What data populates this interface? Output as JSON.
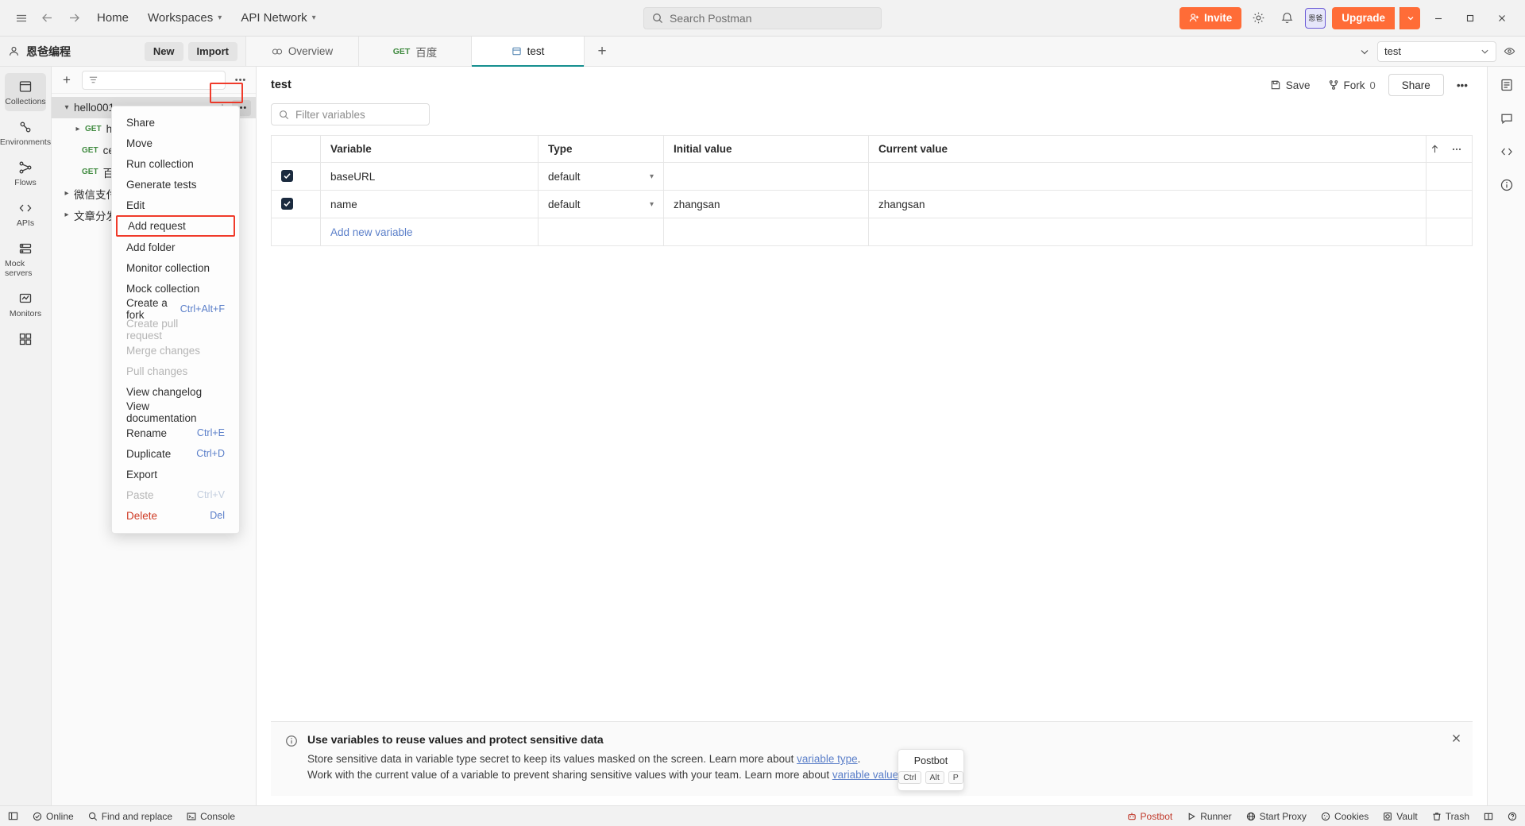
{
  "topbar": {
    "menu_icon": "hamburger-icon",
    "back_icon": "arrow-left-icon",
    "forward_icon": "arrow-right-icon",
    "home_label": "Home",
    "workspaces_label": "Workspaces",
    "api_network_label": "API Network",
    "search_placeholder": "Search Postman",
    "invite_label": "Invite",
    "upgrade_label": "Upgrade",
    "avatar_initials": "恩爸",
    "minimize_label": "—",
    "maximize_label": "□",
    "close_label": "✕"
  },
  "workspace": {
    "name": "恩爸编程",
    "new_label": "New",
    "import_label": "Import"
  },
  "tabs": [
    {
      "label": "Overview",
      "method": "",
      "active": false,
      "icon": "overview-icon"
    },
    {
      "label": "百度",
      "method": "GET",
      "active": false,
      "icon": ""
    },
    {
      "label": "test",
      "method": "",
      "active": true,
      "icon": "collection-icon"
    }
  ],
  "tabstrip": {
    "add_tab_label": "+",
    "chevron_label": "∨",
    "environment_selected": "test"
  },
  "rail": [
    {
      "label": "Collections",
      "icon": "collections-icon",
      "active": true
    },
    {
      "label": "Environments",
      "icon": "environments-icon",
      "active": false
    },
    {
      "label": "Flows",
      "icon": "flows-icon",
      "active": false
    },
    {
      "label": "APIs",
      "icon": "apis-icon",
      "active": false
    },
    {
      "label": "Mock servers",
      "icon": "mock-servers-icon",
      "active": false
    },
    {
      "label": "Monitors",
      "icon": "monitors-icon",
      "active": false
    },
    {
      "label": "",
      "icon": "more-apps-icon",
      "active": false
    }
  ],
  "sidebar": {
    "filter_placeholder": "",
    "plus_label": "+",
    "dots_label": "•••",
    "tree": [
      {
        "label": "hello001",
        "type": "collection",
        "selected": true,
        "expanded": true,
        "indent": 0,
        "method": ""
      },
      {
        "label": "he",
        "type": "request",
        "selected": false,
        "expanded": false,
        "indent": 1,
        "method": "GET"
      },
      {
        "label": "ce",
        "type": "request",
        "selected": false,
        "expanded": false,
        "indent": 2,
        "method": "GET"
      },
      {
        "label": "百..",
        "type": "request",
        "selected": false,
        "expanded": false,
        "indent": 2,
        "method": "GET"
      },
      {
        "label": "微信支付 ..",
        "type": "collection",
        "selected": false,
        "expanded": false,
        "indent": 0,
        "method": ""
      },
      {
        "label": "文章分发平..",
        "type": "collection",
        "selected": false,
        "expanded": false,
        "indent": 0,
        "method": ""
      }
    ]
  },
  "context_menu": {
    "items": [
      {
        "label": "Share",
        "shortcut": "",
        "disabled": false,
        "danger": false,
        "highlight": false
      },
      {
        "label": "Move",
        "shortcut": "",
        "disabled": false,
        "danger": false,
        "highlight": false
      },
      {
        "label": "Run collection",
        "shortcut": "",
        "disabled": false,
        "danger": false,
        "highlight": false
      },
      {
        "label": "Generate tests",
        "shortcut": "",
        "disabled": false,
        "danger": false,
        "highlight": false
      },
      {
        "label": "Edit",
        "shortcut": "",
        "disabled": false,
        "danger": false,
        "highlight": false
      },
      {
        "label": "Add request",
        "shortcut": "",
        "disabled": false,
        "danger": false,
        "highlight": true
      },
      {
        "label": "Add folder",
        "shortcut": "",
        "disabled": false,
        "danger": false,
        "highlight": false
      },
      {
        "label": "Monitor collection",
        "shortcut": "",
        "disabled": false,
        "danger": false,
        "highlight": false
      },
      {
        "label": "Mock collection",
        "shortcut": "",
        "disabled": false,
        "danger": false,
        "highlight": false
      },
      {
        "label": "Create a fork",
        "shortcut": "Ctrl+Alt+F",
        "disabled": false,
        "danger": false,
        "highlight": false
      },
      {
        "label": "Create pull request",
        "shortcut": "",
        "disabled": true,
        "danger": false,
        "highlight": false
      },
      {
        "label": "Merge changes",
        "shortcut": "",
        "disabled": true,
        "danger": false,
        "highlight": false
      },
      {
        "label": "Pull changes",
        "shortcut": "",
        "disabled": true,
        "danger": false,
        "highlight": false
      },
      {
        "label": "View changelog",
        "shortcut": "",
        "disabled": false,
        "danger": false,
        "highlight": false
      },
      {
        "label": "View documentation",
        "shortcut": "",
        "disabled": false,
        "danger": false,
        "highlight": false
      },
      {
        "label": "Rename",
        "shortcut": "Ctrl+E",
        "disabled": false,
        "danger": false,
        "highlight": false
      },
      {
        "label": "Duplicate",
        "shortcut": "Ctrl+D",
        "disabled": false,
        "danger": false,
        "highlight": false
      },
      {
        "label": "Export",
        "shortcut": "",
        "disabled": false,
        "danger": false,
        "highlight": false
      },
      {
        "label": "Paste",
        "shortcut": "Ctrl+V",
        "disabled": true,
        "danger": false,
        "highlight": false
      },
      {
        "label": "Delete",
        "shortcut": "Del",
        "disabled": false,
        "danger": true,
        "highlight": false
      }
    ]
  },
  "main": {
    "title": "test",
    "save_label": "Save",
    "fork_label": "Fork",
    "fork_count": "0",
    "share_label": "Share",
    "more_label": "•••",
    "filter_placeholder": "Filter variables",
    "table": {
      "headers": [
        "",
        "Variable",
        "Type",
        "Initial value",
        "Current value",
        ""
      ],
      "rows": [
        {
          "checked": true,
          "variable": "baseURL",
          "type": "default",
          "initial": "",
          "current": ""
        },
        {
          "checked": true,
          "variable": "name",
          "type": "default",
          "initial": "zhangsan",
          "current": "zhangsan"
        }
      ],
      "add_new_label": "Add new variable"
    }
  },
  "banner": {
    "title": "Use variables to reuse values and protect sensitive data",
    "line1_before": "Store sensitive data in variable type secret to keep its values masked on the screen. Learn more about ",
    "line1_link": "variable type",
    "line1_after": ".",
    "line2_before": "Work with the current value of a variable to prevent sharing sensitive values with your team. Learn more about ",
    "line2_link": "variable values",
    "line2_after": ".",
    "close_label": "✕"
  },
  "postbot_tooltip": {
    "title": "Postbot",
    "keys": [
      "Ctrl",
      "Alt",
      "P"
    ]
  },
  "statusbar": {
    "left": [
      {
        "label": "",
        "icon": "sidebar-toggle-icon"
      },
      {
        "label": "Online",
        "icon": "online-icon"
      },
      {
        "label": "Find and replace",
        "icon": "search-icon"
      },
      {
        "label": "Console",
        "icon": "console-icon"
      }
    ],
    "right": [
      {
        "label": "Postbot",
        "icon": "postbot-icon"
      },
      {
        "label": "Runner",
        "icon": "runner-icon"
      },
      {
        "label": "Start Proxy",
        "icon": "proxy-icon"
      },
      {
        "label": "Cookies",
        "icon": "cookies-icon"
      },
      {
        "label": "Vault",
        "icon": "vault-icon"
      },
      {
        "label": "Trash",
        "icon": "trash-icon"
      },
      {
        "label": "",
        "icon": "layout-icon"
      },
      {
        "label": "",
        "icon": "help-icon"
      }
    ]
  },
  "colors": {
    "accent_orange": "#ff6c37",
    "tab_active_underline": "#168f8f",
    "highlight_red": "#f03b2b",
    "link_blue": "#5b7fc9",
    "method_green": "#3f8a3f",
    "danger_red": "#cf3b25"
  }
}
